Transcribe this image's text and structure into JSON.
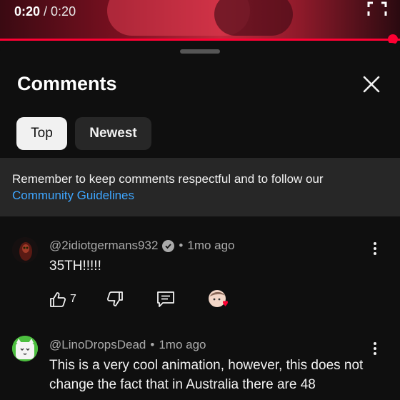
{
  "player": {
    "current_time": "0:20",
    "separator": " / ",
    "duration": "0:20",
    "progress_fraction": 1.0,
    "accent_color": "#ff0033"
  },
  "sheet": {
    "title": "Comments",
    "close_icon": "close-icon",
    "chips": [
      {
        "label": "Top",
        "selected": true
      },
      {
        "label": "Newest",
        "selected": false
      }
    ],
    "notice": {
      "text": "Remember to keep comments respectful and to follow our",
      "link": "Community Guidelines",
      "link_color": "#3ea6ff"
    }
  },
  "comments": [
    {
      "author": "@2idiotgermans932",
      "verified": true,
      "time": "1mo ago",
      "text": "35TH!!!!!",
      "likes": "7",
      "icons": [
        "like-icon",
        "dislike-icon",
        "reply-icon",
        "creator-heart-icon",
        "more-vert-icon"
      ]
    },
    {
      "author": "@LinoDropsDead",
      "verified": false,
      "time": "1mo ago",
      "text": "This is a very cool animation, however, this does not change the fact that in Australia there are 48",
      "icons": [
        "more-vert-icon"
      ]
    }
  ]
}
